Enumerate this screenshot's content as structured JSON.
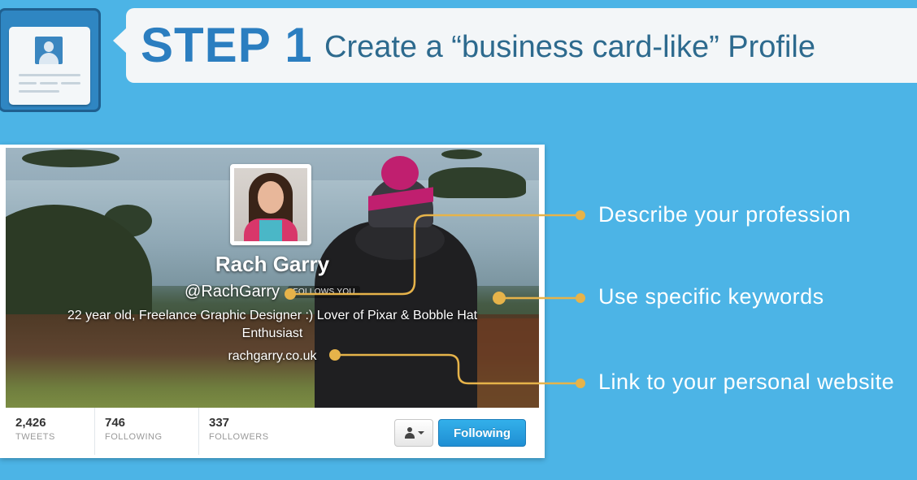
{
  "header": {
    "step_label": "STEP 1",
    "subtitle": "Create a “business card-like” Profile"
  },
  "profile": {
    "name": "Rach Garry",
    "handle": "@RachGarry",
    "follows_you": "FOLLOWS YOU",
    "bio": "22 year old, Freelance Graphic Designer :) Lover of Pixar & Bobble Hat Enthusiast",
    "url": "rachgarry.co.uk",
    "stats": [
      {
        "value": "2,426",
        "label": "TWEETS"
      },
      {
        "value": "746",
        "label": "FOLLOWING"
      },
      {
        "value": "337",
        "label": "FOLLOWERS"
      }
    ],
    "following_button": "Following"
  },
  "callouts": [
    {
      "text": "Describe your profession"
    },
    {
      "text": "Use specific keywords"
    },
    {
      "text": "Link to your personal website"
    }
  ],
  "colors": {
    "background": "#4cb4e6",
    "step_blue": "#2b7ec0",
    "connector_gold": "#e6b34a",
    "following_blue": "#1f8ed3"
  },
  "icons": {
    "step_icon": "profile-card-icon",
    "user_menu": "user-dropdown-icon"
  }
}
